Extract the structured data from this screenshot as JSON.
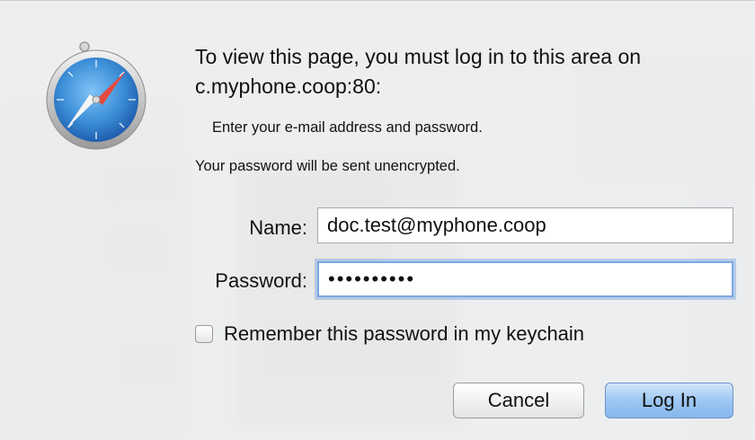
{
  "dialog": {
    "message": "To view this page, you must log in to this area on c.myphone.coop:80:",
    "prompt": "Enter your e-mail address and password.",
    "warning": "Your password will be sent unencrypted.",
    "name_label": "Name:",
    "name_value": "doc.test@myphone.coop",
    "password_label": "Password:",
    "password_value": "••••••••••",
    "remember_label": "Remember this password in my keychain",
    "remember_checked": false,
    "cancel_label": "Cancel",
    "login_label": "Log In"
  },
  "icons": {
    "app_icon": "safari-compass-icon"
  },
  "colors": {
    "focus_ring": "#7aa7e0",
    "default_button": "#9ec6f1"
  }
}
